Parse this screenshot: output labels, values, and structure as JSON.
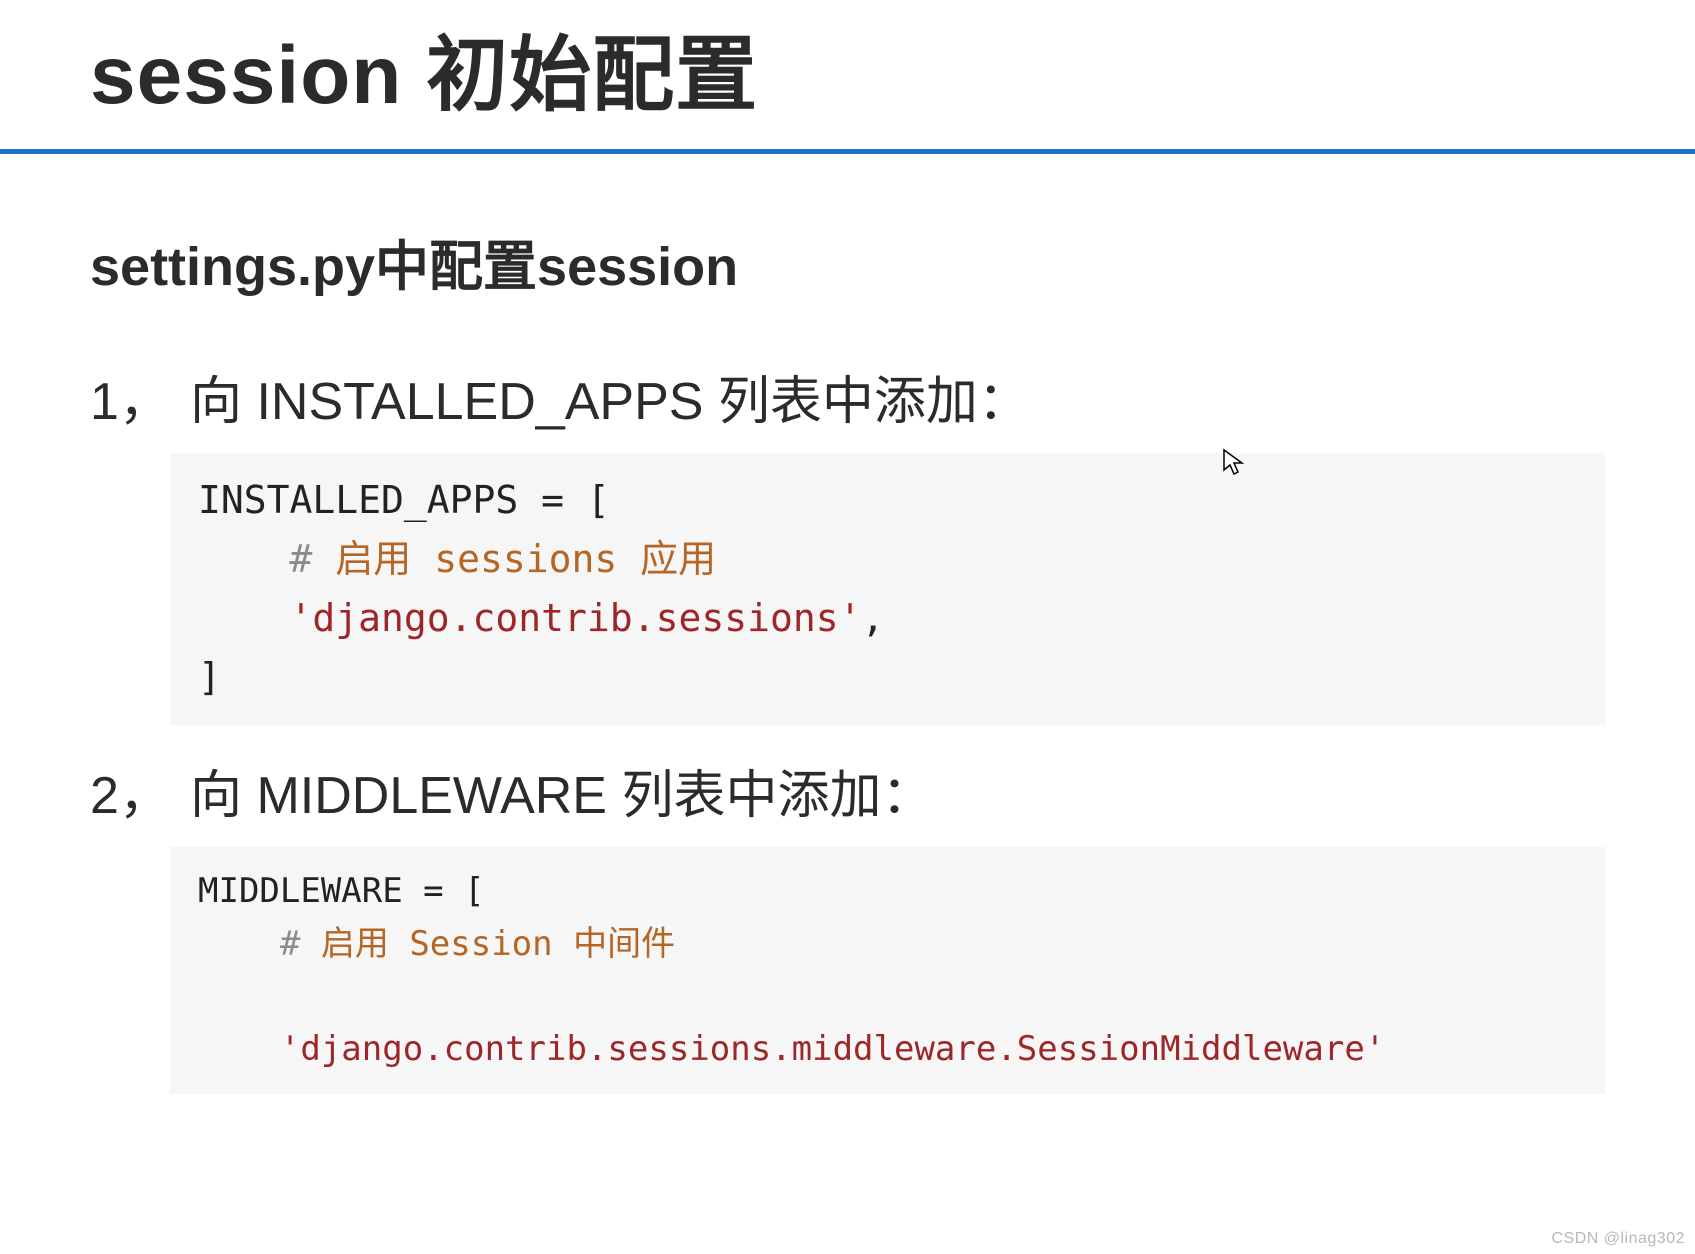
{
  "title": "session 初始配置",
  "subheading": "settings.py中配置session",
  "items": [
    {
      "number": "1，",
      "heading": "向 INSTALLED_APPS 列表中添加：",
      "code": {
        "line1_a": "INSTALLED_APPS",
        "line1_b": " = [",
        "line2_hash": "    # ",
        "line2_w1": "启用",
        "line2_sp1": " ",
        "line2_w2": "sessions",
        "line2_sp2": " ",
        "line2_w3": "应用",
        "line3_indent": "    ",
        "line3_str": "'django.contrib.sessions'",
        "line3_comma": ",",
        "line4": "]"
      }
    },
    {
      "number": "2，",
      "heading": "向 MIDDLEWARE 列表中添加：",
      "code": {
        "line1_a": "MIDDLEWARE",
        "line1_b": " = [",
        "line2_hash": "    # ",
        "line2_w1": "启用",
        "line2_sp1": " ",
        "line2_w2": "Session",
        "line2_sp2": " ",
        "line2_w3": "中间件",
        "blank": "",
        "line3_indent": "    ",
        "line3_str": "'django.contrib.sessions.middleware.SessionMiddleware'"
      }
    }
  ],
  "watermark": "CSDN @linag302"
}
